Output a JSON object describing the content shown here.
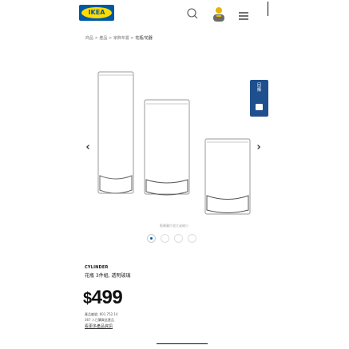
{
  "header": {
    "logo_text": "IKEA",
    "icons": [
      "search-icon",
      "user-icon",
      "menu-icon"
    ],
    "brand_blue": "#0058a3",
    "brand_yellow": "#ffdb00"
  },
  "breadcrumb": [
    "商品",
    "產品",
    "家飾布置",
    "花瓶/花器"
  ],
  "breadcrumb_separator": ">",
  "gallery": {
    "caption": "點擊圖片放大或縮小",
    "side_button_text": [
      "回",
      "購"
    ],
    "dots": 4,
    "active_dot": 0
  },
  "product": {
    "name": "CYLINDER",
    "description": "花瓶 3件組, 透明玻璃",
    "price_currency": "$",
    "price_value": "499",
    "article_line": "產品編號: 601.752.14",
    "stock_line": "367 人已購買此產品",
    "more_link": "看更多產品資訊"
  }
}
